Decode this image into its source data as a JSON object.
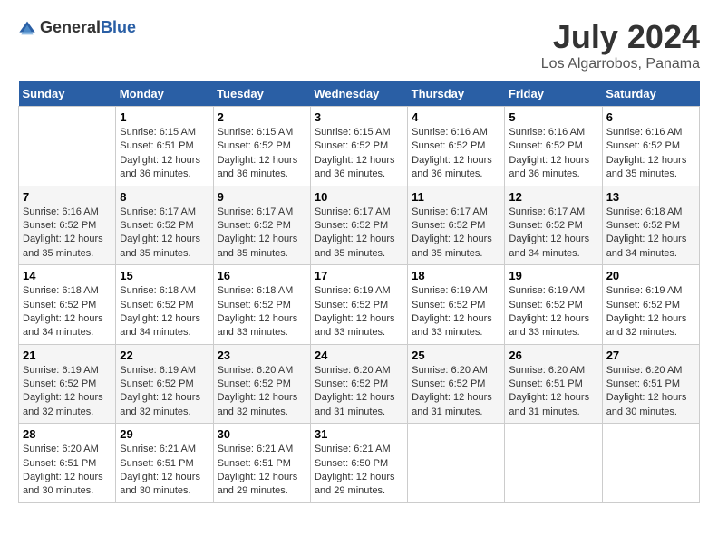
{
  "header": {
    "logo": {
      "general": "General",
      "blue": "Blue"
    },
    "month": "July 2024",
    "location": "Los Algarrobos, Panama"
  },
  "weekdays": [
    "Sunday",
    "Monday",
    "Tuesday",
    "Wednesday",
    "Thursday",
    "Friday",
    "Saturday"
  ],
  "weeks": [
    [
      {
        "day": "",
        "sunrise": "",
        "sunset": "",
        "daylight": ""
      },
      {
        "day": "1",
        "sunrise": "Sunrise: 6:15 AM",
        "sunset": "Sunset: 6:51 PM",
        "daylight": "Daylight: 12 hours and 36 minutes."
      },
      {
        "day": "2",
        "sunrise": "Sunrise: 6:15 AM",
        "sunset": "Sunset: 6:52 PM",
        "daylight": "Daylight: 12 hours and 36 minutes."
      },
      {
        "day": "3",
        "sunrise": "Sunrise: 6:15 AM",
        "sunset": "Sunset: 6:52 PM",
        "daylight": "Daylight: 12 hours and 36 minutes."
      },
      {
        "day": "4",
        "sunrise": "Sunrise: 6:16 AM",
        "sunset": "Sunset: 6:52 PM",
        "daylight": "Daylight: 12 hours and 36 minutes."
      },
      {
        "day": "5",
        "sunrise": "Sunrise: 6:16 AM",
        "sunset": "Sunset: 6:52 PM",
        "daylight": "Daylight: 12 hours and 36 minutes."
      },
      {
        "day": "6",
        "sunrise": "Sunrise: 6:16 AM",
        "sunset": "Sunset: 6:52 PM",
        "daylight": "Daylight: 12 hours and 35 minutes."
      }
    ],
    [
      {
        "day": "7",
        "sunrise": "Sunrise: 6:16 AM",
        "sunset": "Sunset: 6:52 PM",
        "daylight": "Daylight: 12 hours and 35 minutes."
      },
      {
        "day": "8",
        "sunrise": "Sunrise: 6:17 AM",
        "sunset": "Sunset: 6:52 PM",
        "daylight": "Daylight: 12 hours and 35 minutes."
      },
      {
        "day": "9",
        "sunrise": "Sunrise: 6:17 AM",
        "sunset": "Sunset: 6:52 PM",
        "daylight": "Daylight: 12 hours and 35 minutes."
      },
      {
        "day": "10",
        "sunrise": "Sunrise: 6:17 AM",
        "sunset": "Sunset: 6:52 PM",
        "daylight": "Daylight: 12 hours and 35 minutes."
      },
      {
        "day": "11",
        "sunrise": "Sunrise: 6:17 AM",
        "sunset": "Sunset: 6:52 PM",
        "daylight": "Daylight: 12 hours and 35 minutes."
      },
      {
        "day": "12",
        "sunrise": "Sunrise: 6:17 AM",
        "sunset": "Sunset: 6:52 PM",
        "daylight": "Daylight: 12 hours and 34 minutes."
      },
      {
        "day": "13",
        "sunrise": "Sunrise: 6:18 AM",
        "sunset": "Sunset: 6:52 PM",
        "daylight": "Daylight: 12 hours and 34 minutes."
      }
    ],
    [
      {
        "day": "14",
        "sunrise": "Sunrise: 6:18 AM",
        "sunset": "Sunset: 6:52 PM",
        "daylight": "Daylight: 12 hours and 34 minutes."
      },
      {
        "day": "15",
        "sunrise": "Sunrise: 6:18 AM",
        "sunset": "Sunset: 6:52 PM",
        "daylight": "Daylight: 12 hours and 34 minutes."
      },
      {
        "day": "16",
        "sunrise": "Sunrise: 6:18 AM",
        "sunset": "Sunset: 6:52 PM",
        "daylight": "Daylight: 12 hours and 33 minutes."
      },
      {
        "day": "17",
        "sunrise": "Sunrise: 6:19 AM",
        "sunset": "Sunset: 6:52 PM",
        "daylight": "Daylight: 12 hours and 33 minutes."
      },
      {
        "day": "18",
        "sunrise": "Sunrise: 6:19 AM",
        "sunset": "Sunset: 6:52 PM",
        "daylight": "Daylight: 12 hours and 33 minutes."
      },
      {
        "day": "19",
        "sunrise": "Sunrise: 6:19 AM",
        "sunset": "Sunset: 6:52 PM",
        "daylight": "Daylight: 12 hours and 33 minutes."
      },
      {
        "day": "20",
        "sunrise": "Sunrise: 6:19 AM",
        "sunset": "Sunset: 6:52 PM",
        "daylight": "Daylight: 12 hours and 32 minutes."
      }
    ],
    [
      {
        "day": "21",
        "sunrise": "Sunrise: 6:19 AM",
        "sunset": "Sunset: 6:52 PM",
        "daylight": "Daylight: 12 hours and 32 minutes."
      },
      {
        "day": "22",
        "sunrise": "Sunrise: 6:19 AM",
        "sunset": "Sunset: 6:52 PM",
        "daylight": "Daylight: 12 hours and 32 minutes."
      },
      {
        "day": "23",
        "sunrise": "Sunrise: 6:20 AM",
        "sunset": "Sunset: 6:52 PM",
        "daylight": "Daylight: 12 hours and 32 minutes."
      },
      {
        "day": "24",
        "sunrise": "Sunrise: 6:20 AM",
        "sunset": "Sunset: 6:52 PM",
        "daylight": "Daylight: 12 hours and 31 minutes."
      },
      {
        "day": "25",
        "sunrise": "Sunrise: 6:20 AM",
        "sunset": "Sunset: 6:52 PM",
        "daylight": "Daylight: 12 hours and 31 minutes."
      },
      {
        "day": "26",
        "sunrise": "Sunrise: 6:20 AM",
        "sunset": "Sunset: 6:51 PM",
        "daylight": "Daylight: 12 hours and 31 minutes."
      },
      {
        "day": "27",
        "sunrise": "Sunrise: 6:20 AM",
        "sunset": "Sunset: 6:51 PM",
        "daylight": "Daylight: 12 hours and 30 minutes."
      }
    ],
    [
      {
        "day": "28",
        "sunrise": "Sunrise: 6:20 AM",
        "sunset": "Sunset: 6:51 PM",
        "daylight": "Daylight: 12 hours and 30 minutes."
      },
      {
        "day": "29",
        "sunrise": "Sunrise: 6:21 AM",
        "sunset": "Sunset: 6:51 PM",
        "daylight": "Daylight: 12 hours and 30 minutes."
      },
      {
        "day": "30",
        "sunrise": "Sunrise: 6:21 AM",
        "sunset": "Sunset: 6:51 PM",
        "daylight": "Daylight: 12 hours and 29 minutes."
      },
      {
        "day": "31",
        "sunrise": "Sunrise: 6:21 AM",
        "sunset": "Sunset: 6:50 PM",
        "daylight": "Daylight: 12 hours and 29 minutes."
      },
      {
        "day": "",
        "sunrise": "",
        "sunset": "",
        "daylight": ""
      },
      {
        "day": "",
        "sunrise": "",
        "sunset": "",
        "daylight": ""
      },
      {
        "day": "",
        "sunrise": "",
        "sunset": "",
        "daylight": ""
      }
    ]
  ]
}
